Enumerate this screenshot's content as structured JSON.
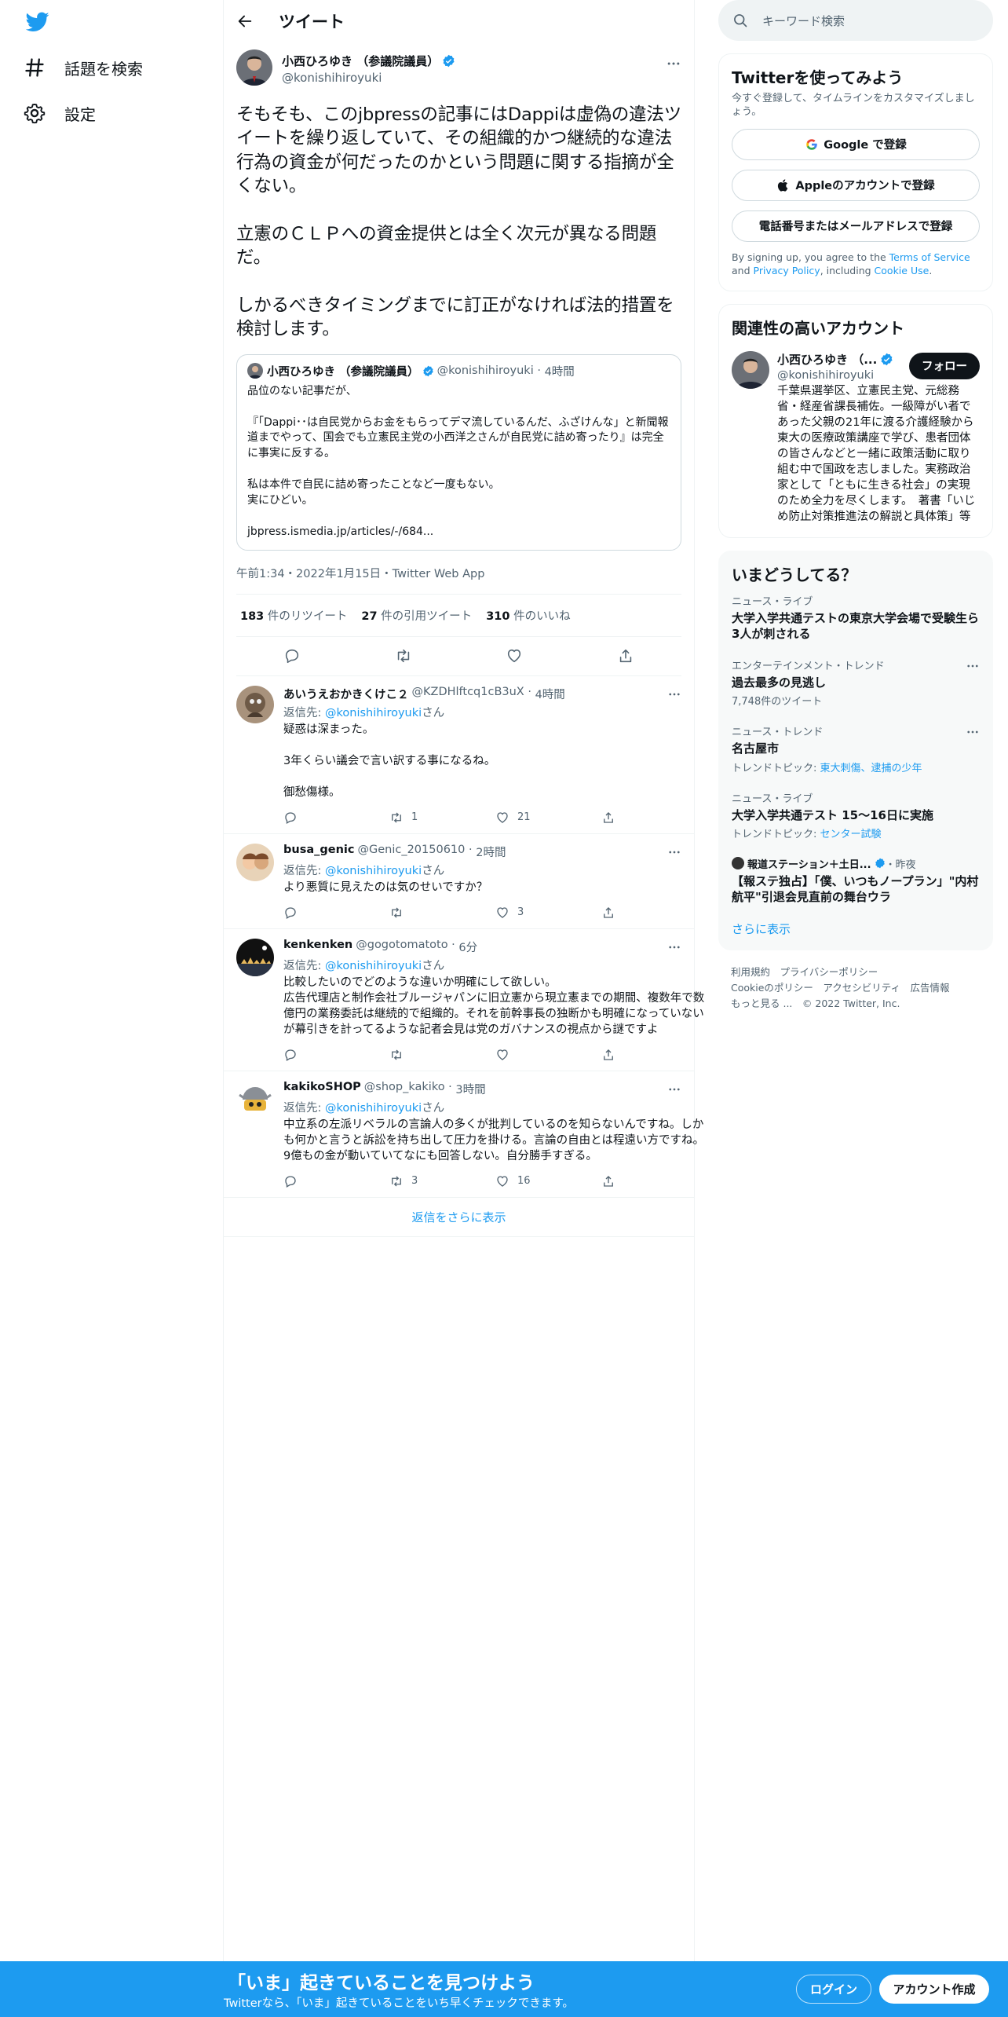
{
  "nav": {
    "explore": "話題を検索",
    "settings": "設定"
  },
  "header": {
    "title": "ツイート"
  },
  "tweet": {
    "name": "小西ひろゆき （参議院議員）",
    "handle": "@konishihiroyuki",
    "text": "そもそも、このjbpressの記事にはDappiは虚偽の違法ツイートを繰り返していて、その組織的かつ継続的な違法行為の資金が何だったのかという問題に関する指摘が全くない。\n\n立憲のＣＬＰへの資金提供とは全く次元が異なる問題だ。\n\nしかるべきタイミングまでに訂正がなければ法的措置を検討します。",
    "quote": {
      "name": "小西ひろゆき （参議院議員）",
      "handle": "@konishihiroyuki",
      "time": "4時間",
      "text": "品位のない記事だが、\n\n『「Dappi･･は自民党からお金をもらってデマ流しているんだ、ふざけんな」と新聞報道までやって、国会でも立憲民主党の小西洋之さんが自民党に詰め寄ったり』は完全に事実に反する。\n\n私は本件で自民に詰め寄ったことなど一度もない。\n実にひどい。\n\njbpress.ismedia.jp/articles/-/684..."
    },
    "meta": "午前1:34・2022年1月15日・Twitter Web App",
    "retweets": "183",
    "retweets_label": "件のリツイート",
    "quotes": "27",
    "quotes_label": "件の引用ツイート",
    "likes": "310",
    "likes_label": "件のいいね"
  },
  "replies": [
    {
      "name": "あいうえおかきくけこ２",
      "handle": "@KZDHlftcq1cB3uX",
      "time": "4時間",
      "reply_to_prefix": "返信先: ",
      "reply_to": "@konishihiroyuki",
      "reply_to_suffix": "さん",
      "text": "疑惑は深まった。\n\n3年くらい議会で言い訳する事になるね。\n\n御愁傷様。",
      "replies": "",
      "retweets": "1",
      "likes": "21"
    },
    {
      "name": "busa_genic",
      "handle": "@Genic_20150610",
      "time": "2時間",
      "reply_to_prefix": "返信先: ",
      "reply_to": "@konishihiroyuki",
      "reply_to_suffix": "さん",
      "text": "より悪質に見えたのは気のせいですか？",
      "replies": "",
      "retweets": "",
      "likes": "3"
    },
    {
      "name": "kenkenken",
      "handle": "@gogotomatoto",
      "time": "6分",
      "reply_to_prefix": "返信先: ",
      "reply_to": "@konishihiroyuki",
      "reply_to_suffix": "さん",
      "text": "比較したいのでどのような違いか明確にして欲しい。\n広告代理店と制作会社ブルージャパンに旧立憲から現立憲までの期間、複数年で数億円の業務委託は継続的で組織的。それを前幹事長の独断かも明確になっていないが幕引きを計ってるような記者会見は党のガバナンスの視点から謎ですよ",
      "replies": "",
      "retweets": "",
      "likes": ""
    },
    {
      "name": "kakikoSHOP",
      "handle": "@shop_kakiko",
      "time": "3時間",
      "reply_to_prefix": "返信先: ",
      "reply_to": "@konishihiroyuki",
      "reply_to_suffix": "さん",
      "text": "中立系の左派リベラルの言論人の多くが批判しているのを知らないんですね。しかも何かと言うと訴訟を持ち出して圧力を掛ける。言論の自由とは程遠い方ですね。9億もの金が動いていてなにも回答しない。自分勝手すぎる。",
      "replies": "",
      "retweets": "3",
      "likes": "16"
    }
  ],
  "show_more_replies": "返信をさらに表示",
  "search": {
    "placeholder": "キーワード検索"
  },
  "signup": {
    "title": "Twitterを使ってみよう",
    "subtitle": "今すぐ登録して、タイムラインをカスタマイズしましょう。",
    "google": "Google で登録",
    "apple": "Appleのアカウントで登録",
    "phone": "電話番号またはメールアドレスで登録",
    "legal_1": "By signing up, you agree to the ",
    "terms": "Terms of Service",
    "legal_2": " and ",
    "privacy": "Privacy Policy",
    "legal_3": ", including ",
    "cookie": "Cookie Use",
    "legal_4": "."
  },
  "related": {
    "title": "関連性の高いアカウント",
    "name": "小西ひろゆき （...",
    "handle": "@konishihiroyuki",
    "follow": "フォロー",
    "bio": "千葉県選挙区、立憲民主党、元総務省・経産省課長補佐。一級障がい者であった父親の21年に渡る介護経験から東大の医療政策講座で学び、患者団体の皆さんなどと一緒に政策活動に取り組む中で国政を志しました。実務政治家として「ともに生きる社会」の実現のため全力を尽くします。　著書「いじめ防止対策推進法の解説と具体策」等"
  },
  "trends": {
    "title": "いまどうしてる？",
    "items": [
      {
        "category": "ニュース・ライブ",
        "title": "大学入学共通テストの東京大学会場で受験生ら3人が刺される",
        "sub": ""
      },
      {
        "category": "エンターテインメント・トレンド",
        "title": "過去最多の見逃し",
        "sub": "7,748件のツイート"
      },
      {
        "category": "ニュース・トレンド",
        "title": "名古屋市",
        "sub_prefix": "トレンドトピック: ",
        "sub_link": "東大刺傷、逮捕の少年"
      },
      {
        "category": "ニュース・ライブ",
        "title": "大学入学共通テスト 15〜16日に実施",
        "sub_prefix": "トレンドトピック: ",
        "sub_link": "センター試験"
      },
      {
        "source": "報道ステーション＋土日...",
        "time": "・昨夜",
        "title": "【報ステ独占】「僕、いつもノープラン」\"内村航平\"引退会見直前の舞台ウラ"
      }
    ],
    "show_more": "さらに表示"
  },
  "footer": {
    "line1": "利用規約　プライバシーポリシー",
    "line2": "Cookieのポリシー　アクセシビリティ　広告情報",
    "line3": "もっと見る ...　© 2022 Twitter, Inc."
  },
  "bottom": {
    "title": "「いま」起きていることを見つけよう",
    "subtitle": "Twitterなら、「いま」起きていることをいち早くチェックできます。",
    "login": "ログイン",
    "signup": "アカウント作成"
  },
  "colors": {
    "accent": "#1d9bf0",
    "text": "#0f1419",
    "muted": "#536471"
  }
}
